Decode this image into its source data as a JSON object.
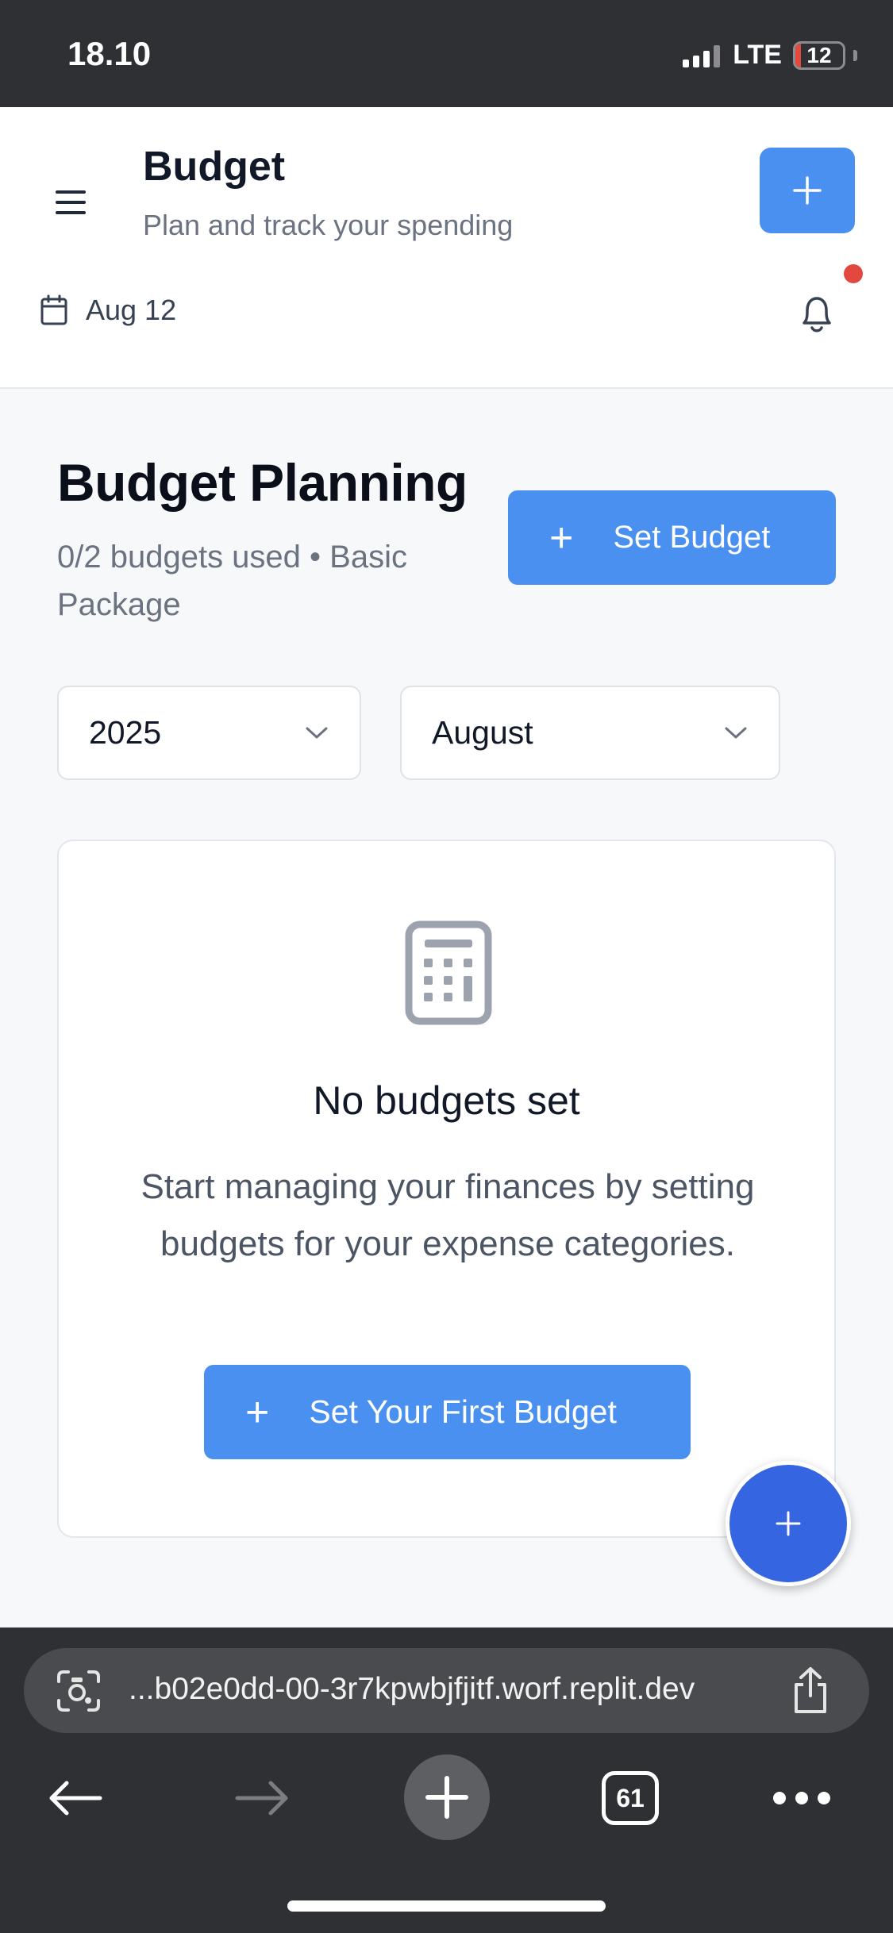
{
  "status_bar": {
    "time": "18.10",
    "network": "LTE",
    "battery_level": "12"
  },
  "header": {
    "title": "Budget",
    "subtitle": "Plan and track your spending",
    "date": "Aug 12",
    "notification_dot_color": "#e2483d"
  },
  "main": {
    "title": "Budget Planning",
    "usage_text": "0/2 budgets used • Basic Package",
    "set_budget_label": "Set Budget",
    "year_select": {
      "selected": "2025"
    },
    "month_select": {
      "selected": "August"
    }
  },
  "empty_state": {
    "title": "No budgets set",
    "description": "Start managing your finances by setting budgets for your expense categories.",
    "button_label": "Set Your First Budget"
  },
  "browser": {
    "url": "...b02e0dd-00-3r7kpwbjfjitf.worf.replit.dev",
    "tab_count": "61"
  },
  "colors": {
    "accent": "#4a90f0",
    "fab": "#3565e0",
    "status_bar_bg": "#2f3033"
  },
  "icons": [
    "menu-icon",
    "plus-icon",
    "calendar-icon",
    "bell-icon",
    "chevron-down-icon",
    "calculator-icon",
    "lens-icon",
    "share-icon",
    "back-arrow-icon",
    "forward-arrow-icon",
    "dots-icon"
  ]
}
